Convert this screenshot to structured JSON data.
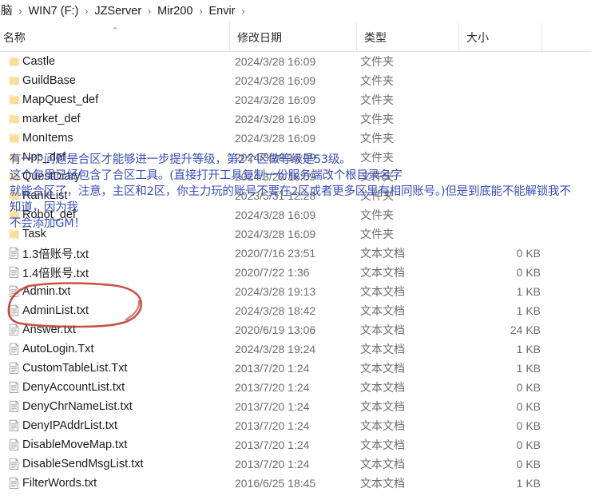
{
  "window": {
    "title": "Envir"
  },
  "breadcrumb": {
    "items": [
      {
        "label": "脑"
      },
      {
        "label": "WIN7 (F:)"
      },
      {
        "label": "JZServer"
      },
      {
        "label": "Mir200"
      },
      {
        "label": "Envir"
      }
    ],
    "separator": "›"
  },
  "columns": {
    "name": "名称",
    "date_modified": "修改日期",
    "type": "类型",
    "size": "大小",
    "sort_indicator": "⌃",
    "sort_column": "名称",
    "sort_direction": "ascending"
  },
  "overlay_note": {
    "color": "#3b4fb8",
    "lines": [
      "有一个问题是合区才能够进一步提升等级，第2个区做等级是53级。",
      "这个包里已经包含了合区工具。(直接打开工具复制一份服务端改个根目录名字",
      "就能合区了，注意，主区和2区，你主力玩的账号不要在2区或者更多区里有相同账号。)但是到底能不能解锁我不",
      "知道，因为我",
      "不会添加GM！"
    ]
  },
  "red_annotation": {
    "color": "#c0392b",
    "shape": "hand-drawn-ellipse",
    "encircles": [
      "Admin.txt",
      "AdminList.txt"
    ]
  },
  "files": [
    {
      "name": "Castle",
      "date": "2024/3/28 16:09",
      "type": "文件夹",
      "size": "",
      "icon": "folder-icon"
    },
    {
      "name": "GuildBase",
      "date": "2024/3/28 16:09",
      "type": "文件夹",
      "size": "",
      "icon": "folder-icon"
    },
    {
      "name": "MapQuest_def",
      "date": "2024/3/28 16:09",
      "type": "文件夹",
      "size": "",
      "icon": "folder-icon"
    },
    {
      "name": "market_def",
      "date": "2024/3/28 16:09",
      "type": "文件夹",
      "size": "",
      "icon": "folder-icon"
    },
    {
      "name": "MonItems",
      "date": "2024/3/28 16:09",
      "type": "文件夹",
      "size": "",
      "icon": "folder-icon"
    },
    {
      "name": "Npc_def",
      "date": "2024/3/28 16:09",
      "type": "文件夹",
      "size": "",
      "icon": "folder-icon"
    },
    {
      "name": "QuestDiary",
      "date": "2024/3/28 16:09",
      "type": "文件夹",
      "size": "",
      "icon": "folder-icon"
    },
    {
      "name": "RankList",
      "date": "2023/5/31 12:28",
      "type": "文件夹",
      "size": "",
      "icon": "folder-icon"
    },
    {
      "name": "Robot_def",
      "date": "2024/3/28 16:09",
      "type": "文件夹",
      "size": "",
      "icon": "folder-icon"
    },
    {
      "name": "Task",
      "date": "2024/3/28 16:09",
      "type": "文件夹",
      "size": "",
      "icon": "folder-icon"
    },
    {
      "name": "1.3倍账号.txt",
      "date": "2020/7/16 23:51",
      "type": "文本文档",
      "size": "0 KB",
      "icon": "text-document-icon"
    },
    {
      "name": "1.4倍账号.txt",
      "date": "2020/7/22 1:36",
      "type": "文本文档",
      "size": "0 KB",
      "icon": "text-document-icon"
    },
    {
      "name": "Admin.txt",
      "date": "2024/3/28 19:13",
      "type": "文本文档",
      "size": "1 KB",
      "icon": "text-document-icon"
    },
    {
      "name": "AdminList.txt",
      "date": "2024/3/28 18:42",
      "type": "文本文档",
      "size": "1 KB",
      "icon": "text-document-icon"
    },
    {
      "name": "Answer.txt",
      "date": "2020/6/19 13:06",
      "type": "文本文档",
      "size": "24 KB",
      "icon": "text-document-icon"
    },
    {
      "name": "AutoLogin.Txt",
      "date": "2024/3/28 19:24",
      "type": "文本文档",
      "size": "1 KB",
      "icon": "text-document-icon"
    },
    {
      "name": "CustomTableList.Txt",
      "date": "2013/7/20 1:24",
      "type": "文本文档",
      "size": "1 KB",
      "icon": "text-document-icon"
    },
    {
      "name": "DenyAccountList.txt",
      "date": "2013/7/20 1:24",
      "type": "文本文档",
      "size": "0 KB",
      "icon": "text-document-icon"
    },
    {
      "name": "DenyChrNameList.txt",
      "date": "2013/7/20 1:24",
      "type": "文本文档",
      "size": "0 KB",
      "icon": "text-document-icon"
    },
    {
      "name": "DenyIPAddrList.txt",
      "date": "2013/7/20 1:24",
      "type": "文本文档",
      "size": "0 KB",
      "icon": "text-document-icon"
    },
    {
      "name": "DisableMoveMap.txt",
      "date": "2013/7/20 1:24",
      "type": "文本文档",
      "size": "0 KB",
      "icon": "text-document-icon"
    },
    {
      "name": "DisableSendMsgList.txt",
      "date": "2013/7/20 1:24",
      "type": "文本文档",
      "size": "0 KB",
      "icon": "text-document-icon"
    },
    {
      "name": "FilterWords.txt",
      "date": "2016/6/25 18:45",
      "type": "文本文档",
      "size": "1 KB",
      "icon": "text-document-icon"
    }
  ]
}
